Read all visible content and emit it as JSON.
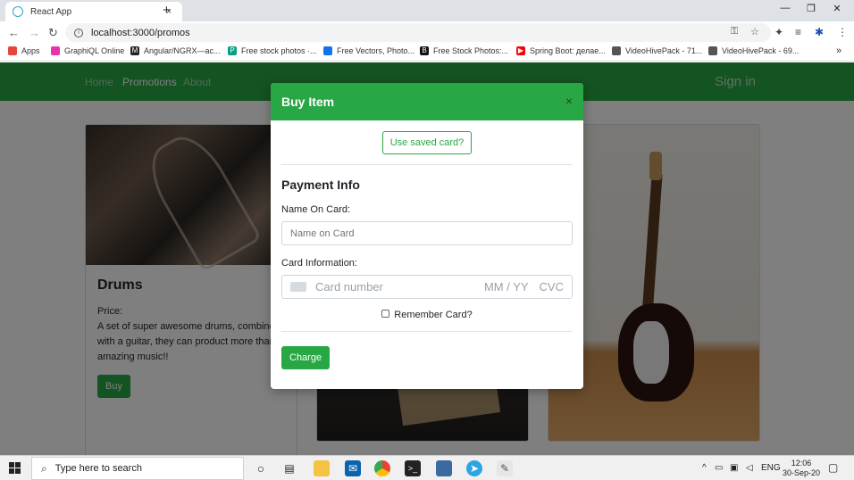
{
  "browser": {
    "tab_title": "React App",
    "tab_close": "×",
    "new_tab": "+",
    "url": "localhost:3000/promos",
    "win_minimize": "—",
    "win_restore": "❐",
    "win_close": "✕",
    "bookmarks": [
      {
        "label": "Apps",
        "color": "#e8453c"
      },
      {
        "label": "GraphiQL Online",
        "color": "#e535ab"
      },
      {
        "label": "Angular/NGRX—ас...",
        "color": "#222222"
      },
      {
        "label": "Free stock photos ·...",
        "color": "#05a081"
      },
      {
        "label": "Free Vectors, Photo...",
        "color": "#1273eb"
      },
      {
        "label": "Free Stock Photos:...",
        "color": "#111111"
      },
      {
        "label": "Spring Boot: делае...",
        "color": "#ff0000"
      },
      {
        "label": "VideoHivePack - 71...",
        "color": "#555555"
      },
      {
        "label": "VideoHivePack - 69...",
        "color": "#555555"
      }
    ],
    "bookmarks_more": "»"
  },
  "site": {
    "nav_home": "Home",
    "nav_promotions": "Promotions",
    "nav_about": "About",
    "sign_in": "Sign in",
    "accent": "#28a745"
  },
  "cards": {
    "drums_title": "Drums",
    "drums_price": "Price:",
    "drums_desc": "A set of super awesome drums, combined with a guitar, they can product more than amazing music!!",
    "buy_label": "Buy"
  },
  "modal": {
    "title": "Buy Item",
    "close": "×",
    "saved_card": "Use saved card?",
    "heading": "Payment Info",
    "name_label": "Name On Card:",
    "name_placeholder": "Name on Card",
    "card_label": "Card Information:",
    "card_number_placeholder": "Card number",
    "card_expiry_placeholder": "MM / YY",
    "card_cvc_placeholder": "CVC",
    "remember_label": "Remember Card?",
    "charge_label": "Charge"
  },
  "taskbar": {
    "search_placeholder": "Type here to search",
    "lang": "ENG",
    "time": "12:06",
    "date": "30-Sep-20"
  }
}
